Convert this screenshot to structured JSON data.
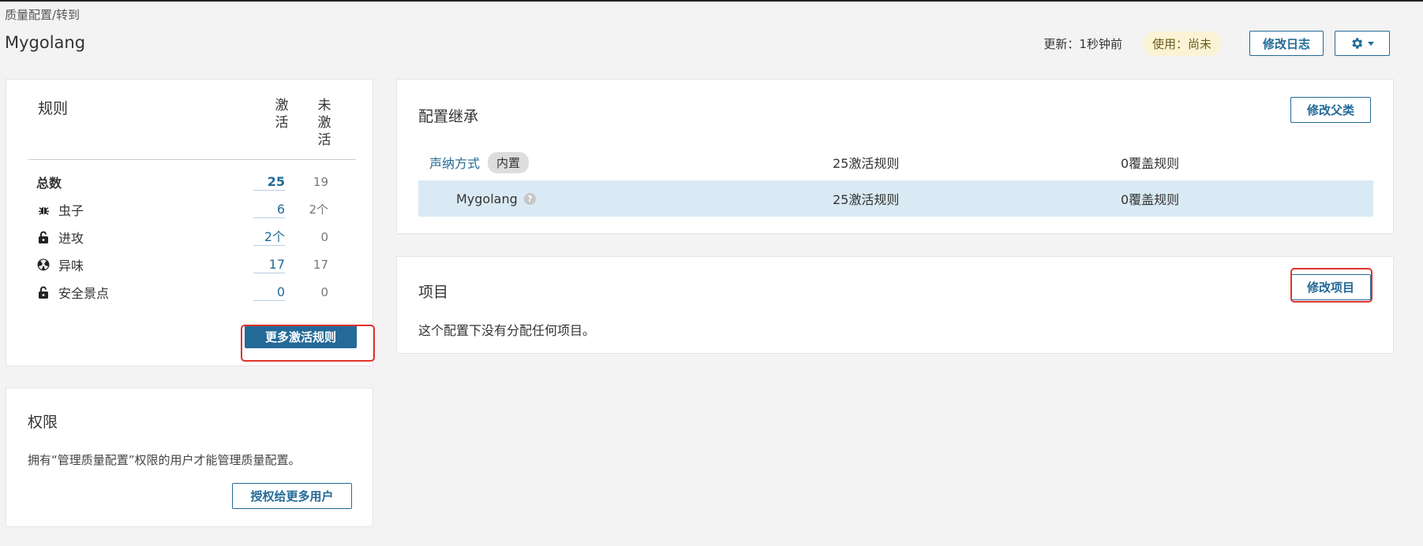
{
  "breadcrumb": "质量配置/转到",
  "title": "Mygolang",
  "header": {
    "updated": "更新：1秒钟前",
    "usage": "使用：尚未",
    "changelog_label": "修改日志",
    "gear_icon": "gear-icon"
  },
  "rules": {
    "title": "规则",
    "col_active": "激\n活",
    "col_inactive": "未\n激\n活",
    "rows": [
      {
        "label": "总数",
        "active": "25",
        "inactive": "19",
        "icon": ""
      },
      {
        "label": "虫子",
        "active": "6",
        "inactive": "2个",
        "icon": "bug-icon"
      },
      {
        "label": "进攻",
        "active": "2个",
        "inactive": "0",
        "icon": "unlock-icon"
      },
      {
        "label": "异味",
        "active": "17",
        "inactive": "17",
        "icon": "radiation-icon"
      },
      {
        "label": "安全景点",
        "active": "0",
        "inactive": "0",
        "icon": "unlock-icon"
      }
    ],
    "more_button": "更多激活规则"
  },
  "permissions": {
    "title": "权限",
    "text": "拥有“管理质量配置”权限的用户才能管理质量配置。",
    "button": "授权给更多用户"
  },
  "inheritance": {
    "title": "配置继承",
    "button": "修改父类",
    "rows": [
      {
        "name": "声纳方式",
        "badge": "内置",
        "active": "25激活规则",
        "overrides": "0覆盖规则"
      },
      {
        "name": "Mygolang",
        "active": "25激活规则",
        "overrides": "0覆盖规则"
      }
    ]
  },
  "projects": {
    "title": "项目",
    "button": "修改项目",
    "text": "这个配置下没有分配任何项目。"
  },
  "colors": {
    "accent": "#236a97",
    "highlight_row": "#d9eaf4",
    "annotation_red": "#e0322c"
  }
}
